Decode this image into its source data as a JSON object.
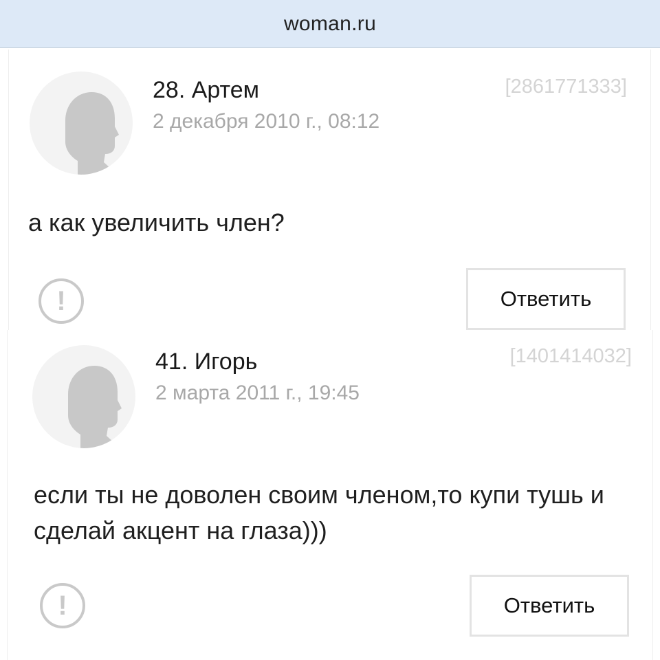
{
  "header": {
    "site_title": "woman.ru"
  },
  "comments": [
    {
      "author": "28. Артем",
      "date": "2 декабря 2010 г., 08:12",
      "id": "[2861771333]",
      "text": "а как увеличить член?",
      "reply_label": "Ответить",
      "report_icon": "exclamation-circle-icon",
      "avatar_icon": "user-silhouette-icon"
    },
    {
      "author": "41. Игорь",
      "date": "2 марта 2011 г., 19:45",
      "id": "[1401414032]",
      "text": "если ты не доволен своим членом,то купи тушь и сделай акцент на глаза)))",
      "reply_label": "Ответить",
      "report_icon": "exclamation-circle-icon",
      "avatar_icon": "user-silhouette-icon"
    }
  ],
  "colors": {
    "header_bg": "#dde9f7",
    "avatar_silhouette": "#c8c8c8",
    "muted_text": "#a8a8a8"
  }
}
